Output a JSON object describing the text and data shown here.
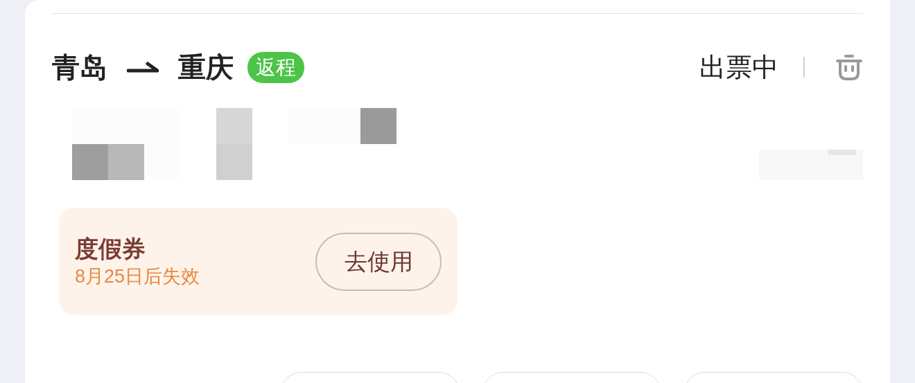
{
  "trip": {
    "from": "青岛",
    "to": "重庆",
    "badge": "返程",
    "status": "出票中"
  },
  "coupon": {
    "title": "度假券",
    "expiry": "8月25日后失效",
    "button": "去使用"
  }
}
